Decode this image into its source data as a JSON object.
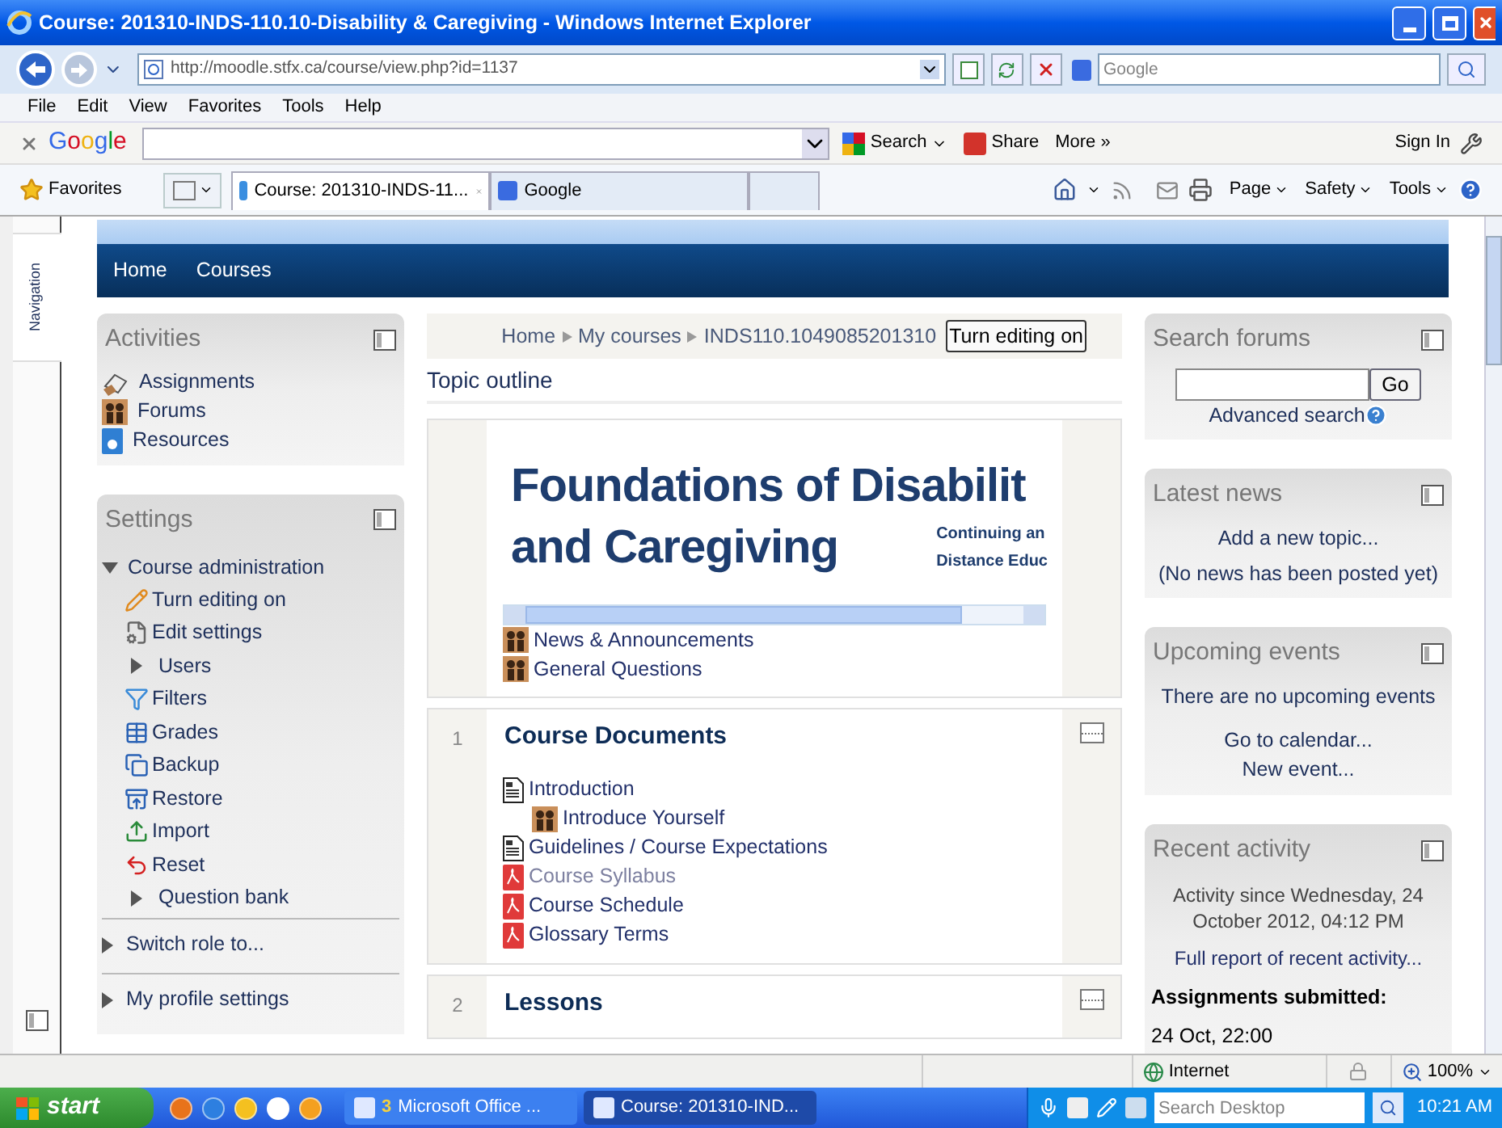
{
  "window": {
    "title": "Course: 201310-INDS-110.10-Disability & Caregiving - Windows Internet Explorer"
  },
  "address_bar": {
    "url": "http://moodle.stfx.ca/course/view.php?id=1137",
    "search_placeholder": "Google"
  },
  "menu": [
    "File",
    "Edit",
    "View",
    "Favorites",
    "Tools",
    "Help"
  ],
  "google_toolbar": {
    "logo": "Google",
    "buttons": [
      "Search",
      "Share",
      "More »"
    ],
    "sign_in": "Sign In"
  },
  "favorites_bar": {
    "label": "Favorites",
    "tabs": [
      {
        "label": "Course: 201310-INDS-11...",
        "selected": true
      },
      {
        "label": "Google",
        "selected": false
      }
    ],
    "commands": [
      "Page",
      "Safety",
      "Tools"
    ]
  },
  "dock": {
    "label": "Navigation"
  },
  "site_nav": [
    "Home",
    "Courses"
  ],
  "activities": {
    "title": "Activities",
    "items": [
      {
        "label": "Assignments",
        "kind": "assignment"
      },
      {
        "label": "Forums",
        "kind": "forum"
      },
      {
        "label": "Resources",
        "kind": "resource"
      }
    ]
  },
  "settings": {
    "title": "Settings",
    "section": {
      "label": "Course administration",
      "expanded": true,
      "items": [
        {
          "label": "Turn editing on",
          "kind": "edit"
        },
        {
          "label": "Edit settings",
          "kind": "settings"
        },
        {
          "label": "Users",
          "kind": "branch",
          "expanded": false
        },
        {
          "label": "Filters",
          "kind": "filter"
        },
        {
          "label": "Grades",
          "kind": "grades"
        },
        {
          "label": "Backup",
          "kind": "backup"
        },
        {
          "label": "Restore",
          "kind": "restore"
        },
        {
          "label": "Import",
          "kind": "import"
        },
        {
          "label": "Reset",
          "kind": "reset"
        },
        {
          "label": "Question bank",
          "kind": "branch",
          "expanded": false
        }
      ]
    },
    "more": [
      {
        "label": "Switch role to...",
        "expanded": false
      },
      {
        "label": "My profile settings",
        "expanded": false
      }
    ]
  },
  "breadcrumb": [
    "Home",
    "My courses",
    "INDS110.1049085201310"
  ],
  "edit_button": "Turn editing on",
  "heading": "Topic outline",
  "banner": {
    "line_1": "Foundations of Disabilit",
    "line_2": "and Caregiving",
    "logo_line_1": "Continuing an",
    "logo_line_2": "Distance Educ"
  },
  "section_0": {
    "items": [
      {
        "label": "News & Announcements",
        "kind": "forum"
      },
      {
        "label": "General Questions",
        "kind": "forum"
      }
    ]
  },
  "section_1": {
    "number": "1",
    "title": "Course Documents",
    "items": [
      {
        "label": "Introduction",
        "kind": "page",
        "dimmed": false,
        "children": [
          {
            "label": "Introduce Yourself",
            "kind": "forum",
            "dimmed": false
          }
        ]
      },
      {
        "label": "Guidelines / Course Expectations",
        "kind": "page",
        "dimmed": false
      },
      {
        "label": "Course Syllabus",
        "kind": "pdf",
        "dimmed": true
      },
      {
        "label": "Course Schedule",
        "kind": "pdf",
        "dimmed": false
      },
      {
        "label": "Glossary Terms",
        "kind": "pdf",
        "dimmed": false
      }
    ]
  },
  "section_2": {
    "number": "2",
    "title": "Lessons"
  },
  "search_forums": {
    "title": "Search forums",
    "button": "Go",
    "link": "Advanced search"
  },
  "latest_news": {
    "title": "Latest news",
    "link": "Add a new topic...",
    "note": "(No news has been posted yet)"
  },
  "upcoming_events": {
    "title": "Upcoming events",
    "note": "There are no upcoming events",
    "links": [
      "Go to calendar...",
      "New event..."
    ]
  },
  "recent_activity": {
    "title": "Recent activity",
    "since": "Activity since Wednesday, 24 October 2012, 04:12 PM",
    "link": "Full report of recent activity...",
    "subheading": "Assignments submitted:",
    "entry": "24 Oct, 22:00"
  },
  "status_bar": {
    "zone": "Internet",
    "zoom": "100%"
  },
  "taskbar": {
    "start": "start",
    "tasks": [
      {
        "count": "3",
        "label": "Microsoft Office ...",
        "selected": false
      },
      {
        "label": "Course: 201310-IND...",
        "selected": true
      }
    ],
    "search_placeholder": "Search Desktop",
    "time": "10:21 AM"
  }
}
